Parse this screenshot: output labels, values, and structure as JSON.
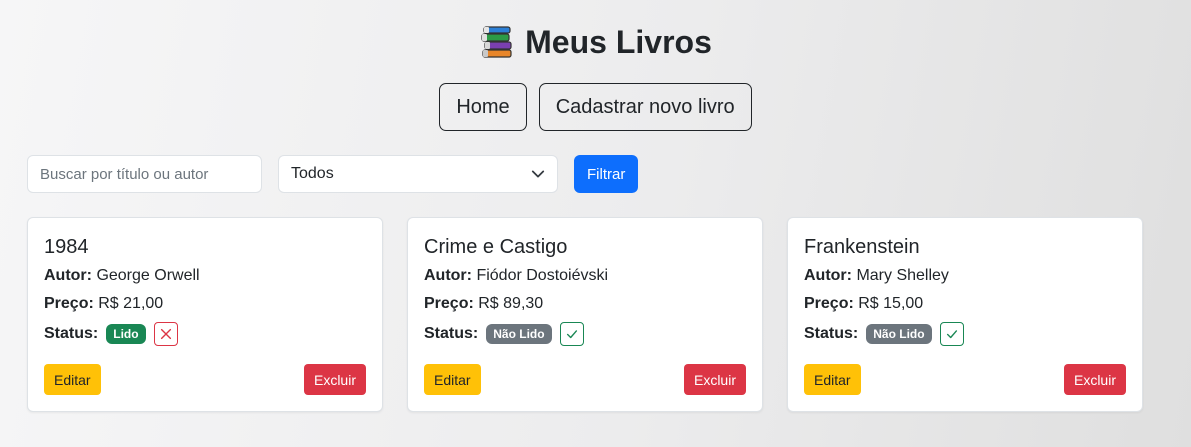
{
  "header": {
    "title": "Meus Livros",
    "icon": "books-icon"
  },
  "nav": {
    "home_label": "Home",
    "new_book_label": "Cadastrar novo livro"
  },
  "filters": {
    "search_placeholder": "Buscar por título ou autor",
    "search_value": "",
    "status_selected": "Todos",
    "filter_button_label": "Filtrar"
  },
  "labels": {
    "author": "Autor:",
    "price": "Preço:",
    "status": "Status:",
    "edit": "Editar",
    "delete": "Excluir"
  },
  "books": [
    {
      "title": "1984",
      "author": "George Orwell",
      "price": "R$ 21,00",
      "status": "Lido",
      "toggle_icon": "x-icon"
    },
    {
      "title": "Crime e Castigo",
      "author": "Fiódor Dostoiévski",
      "price": "R$ 89,30",
      "status": "Não Lido",
      "toggle_icon": "check-icon"
    },
    {
      "title": "Frankenstein",
      "author": "Mary Shelley",
      "price": "R$ 15,00",
      "status": "Não Lido",
      "toggle_icon": "check-icon"
    }
  ],
  "colors": {
    "primary": "#0d6efd",
    "success": "#198754",
    "secondary": "#6c757d",
    "warning": "#ffc107",
    "danger": "#dc3545"
  }
}
